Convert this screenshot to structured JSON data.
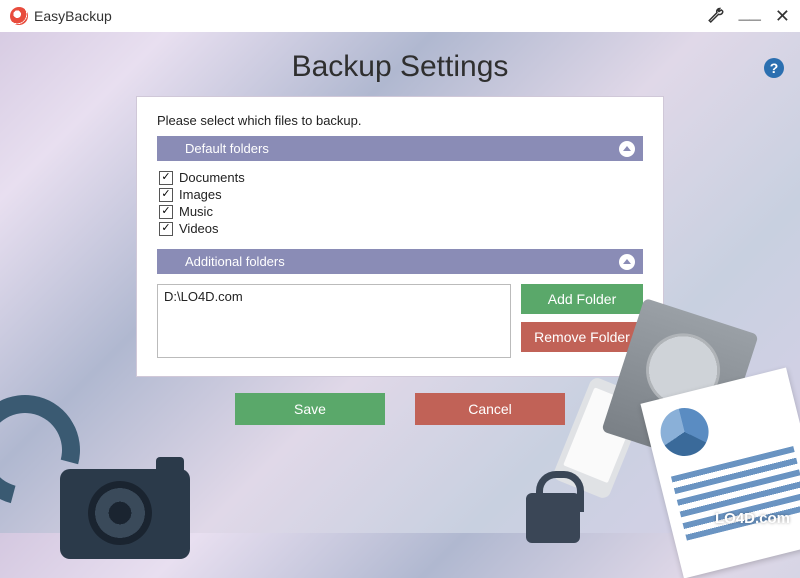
{
  "app": {
    "title": "EasyBackup"
  },
  "heading": "Backup Settings",
  "instruction": "Please select which files to backup.",
  "sections": {
    "default": {
      "title": "Default folders",
      "items": [
        {
          "label": "Documents",
          "checked": true
        },
        {
          "label": "Images",
          "checked": true
        },
        {
          "label": "Music",
          "checked": true
        },
        {
          "label": "Videos",
          "checked": true
        }
      ]
    },
    "additional": {
      "title": "Additional folders",
      "paths": [
        "D:\\LO4D.com"
      ],
      "add_label": "Add Folder",
      "remove_label": "Remove Folder"
    }
  },
  "actions": {
    "save": "Save",
    "cancel": "Cancel"
  },
  "watermark": "LO4D.com"
}
